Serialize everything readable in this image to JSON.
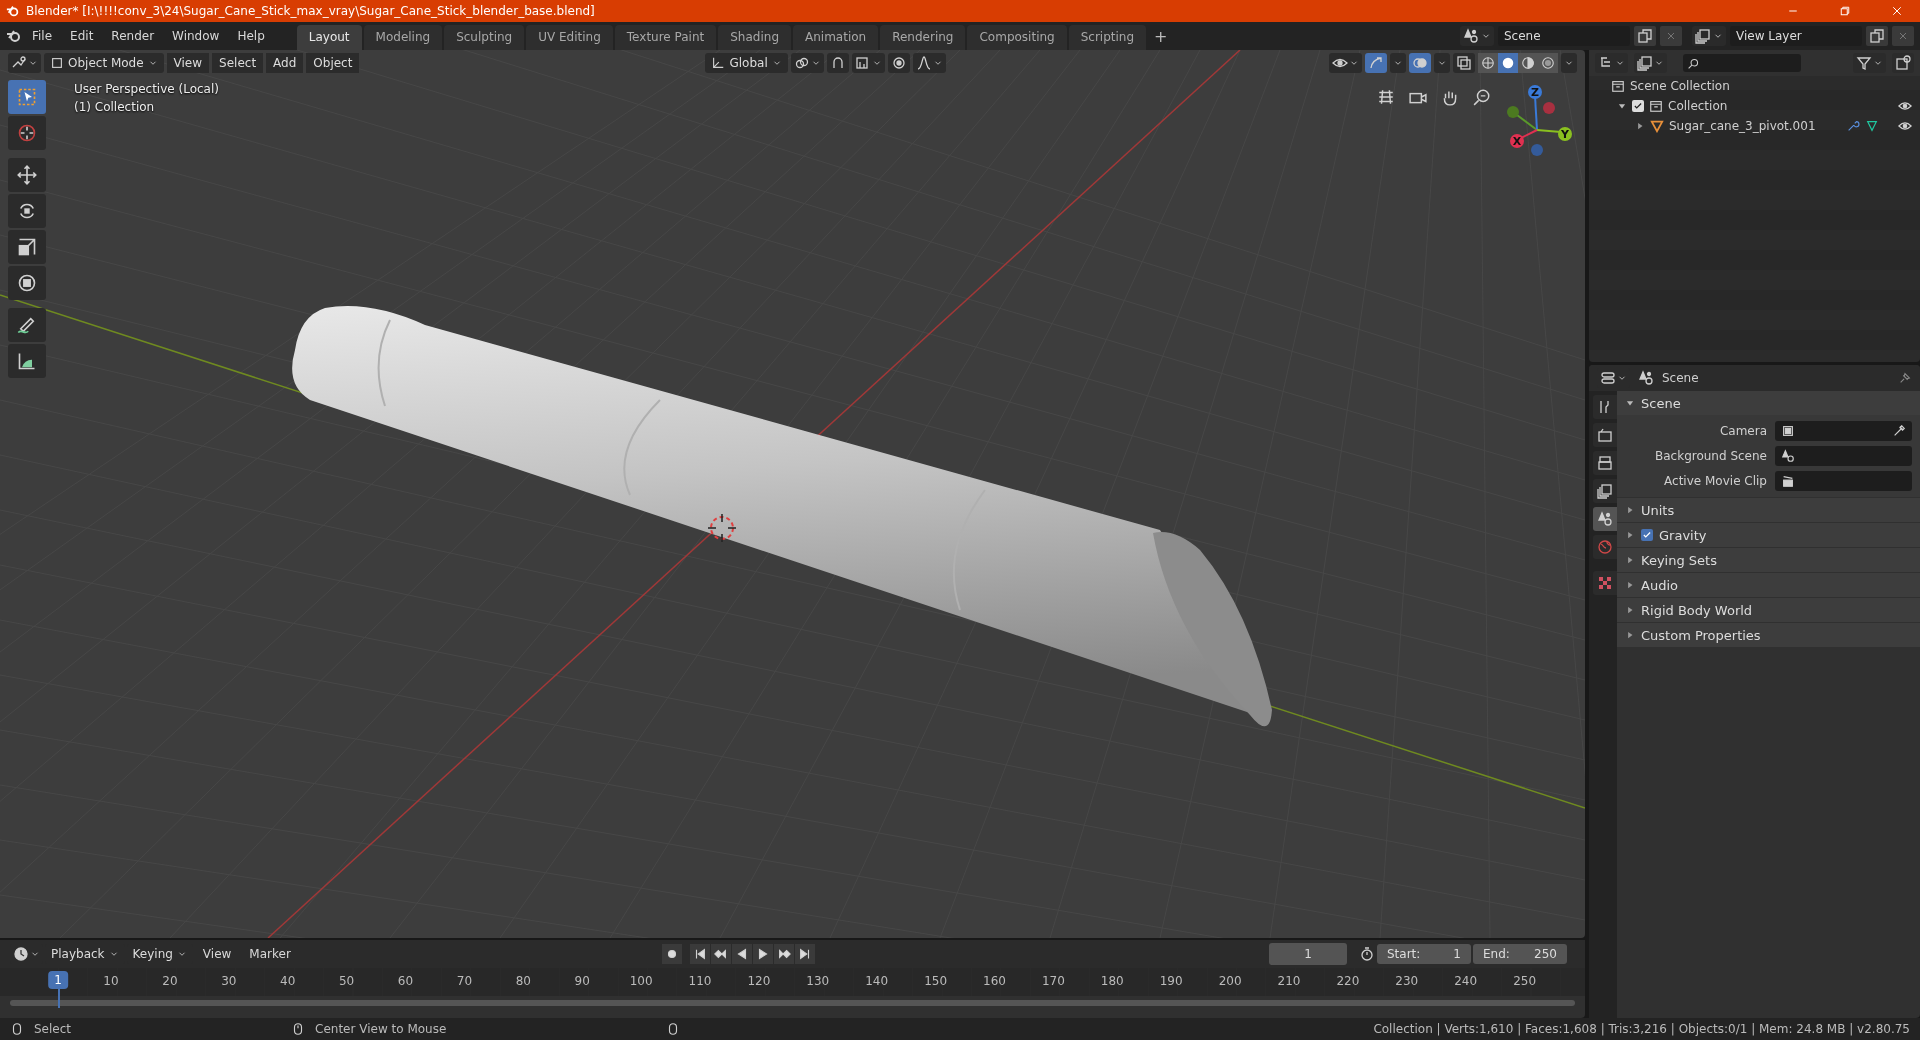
{
  "window": {
    "title": "Blender* [I:\\!!!!conv_3\\24\\Sugar_Cane_Stick_max_vray\\Sugar_Cane_Stick_blender_base.blend]"
  },
  "menu": [
    "File",
    "Edit",
    "Render",
    "Window",
    "Help"
  ],
  "workspaces": [
    {
      "label": "Layout",
      "selected": true
    },
    {
      "label": "Modeling",
      "selected": false
    },
    {
      "label": "Sculpting",
      "selected": false
    },
    {
      "label": "UV Editing",
      "selected": false
    },
    {
      "label": "Texture Paint",
      "selected": false
    },
    {
      "label": "Shading",
      "selected": false
    },
    {
      "label": "Animation",
      "selected": false
    },
    {
      "label": "Rendering",
      "selected": false
    },
    {
      "label": "Compositing",
      "selected": false
    },
    {
      "label": "Scripting",
      "selected": false
    }
  ],
  "add_workspace": "+",
  "scene_field": {
    "value": "Scene"
  },
  "view_layer_field": {
    "value": "View Layer"
  },
  "viewport": {
    "mode": "Object Mode",
    "menus": [
      "View",
      "Select",
      "Add",
      "Object"
    ],
    "orientation": "Global",
    "shading_modes": [
      {
        "kind": "wireframe",
        "selected": false
      },
      {
        "kind": "solid",
        "selected": true
      },
      {
        "kind": "material",
        "selected": false
      },
      {
        "kind": "rendered",
        "selected": false
      }
    ],
    "overlay_lines": [
      "User Perspective (Local)",
      "(1) Collection"
    ],
    "tools": [
      {
        "kind": "select",
        "selected": true
      },
      {
        "kind": "cursor",
        "selected": false
      },
      {
        "kind": "move",
        "selected": false
      },
      {
        "kind": "rotate",
        "selected": false
      },
      {
        "kind": "scale",
        "selected": false
      },
      {
        "kind": "transform",
        "selected": false
      },
      {
        "kind": "annotate",
        "selected": false
      },
      {
        "kind": "measure",
        "selected": false
      }
    ],
    "gizmo_axes": [
      "X",
      "Y",
      "Z"
    ]
  },
  "outliner": {
    "items": [
      {
        "label": "Scene Collection",
        "children": [
          {
            "label": "Collection",
            "checked": true,
            "expanded": true,
            "children": [
              {
                "label": "Sugar_cane_3_pivot.001",
                "expanded": false
              }
            ]
          }
        ]
      }
    ]
  },
  "properties": {
    "header": "Scene",
    "tabs": [
      {
        "kind": "tool",
        "selected": false
      },
      {
        "kind": "render",
        "selected": false
      },
      {
        "kind": "output",
        "selected": false
      },
      {
        "kind": "view_layer",
        "selected": false
      },
      {
        "kind": "scene",
        "selected": true
      },
      {
        "kind": "world",
        "selected": false
      },
      {
        "kind": "texture",
        "selected": false
      }
    ],
    "panel": {
      "title": "Scene",
      "expanded": true,
      "fields": [
        {
          "label": "Camera",
          "kind": "camera"
        },
        {
          "label": "Background Scene",
          "kind": "scene"
        },
        {
          "label": "Active Movie Clip",
          "kind": "clip"
        }
      ]
    },
    "sections": [
      {
        "label": "Units",
        "expanded": false,
        "kind": "plain"
      },
      {
        "label": "Gravity",
        "expanded": false,
        "kind": "checkbox",
        "checked": true
      },
      {
        "label": "Keying Sets",
        "expanded": false,
        "kind": "plain"
      },
      {
        "label": "Audio",
        "expanded": false,
        "kind": "plain"
      },
      {
        "label": "Rigid Body World",
        "expanded": false,
        "kind": "plain"
      },
      {
        "label": "Custom Properties",
        "expanded": false,
        "kind": "plain"
      }
    ]
  },
  "timeline": {
    "menus": [
      "Playback",
      "Keying",
      "View",
      "Marker"
    ],
    "current_frame": "1",
    "start_label": "Start:",
    "start": "1",
    "end_label": "End:",
    "end": "250",
    "ruler_current": "1",
    "ruler_ticks": [
      "10",
      "20",
      "30",
      "40",
      "50",
      "60",
      "70",
      "80",
      "90",
      "100",
      "110",
      "120",
      "130",
      "140",
      "150",
      "160",
      "170",
      "180",
      "190",
      "200",
      "210",
      "220",
      "230",
      "240",
      "250"
    ]
  },
  "status_bar": {
    "hints": [
      "Select",
      "Center View to Mouse"
    ],
    "stats": "Collection | Verts:1,610 | Faces:1,608 | Tris:3,216 | Objects:0/1 | Mem: 24.8 MB | v2.80.75"
  }
}
